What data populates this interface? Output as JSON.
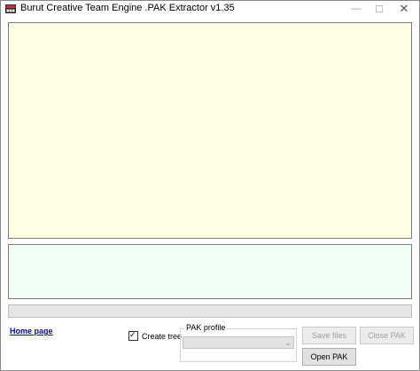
{
  "window": {
    "title": "Burut Creative Team Engine .PAK Extractor v1.35",
    "icon": "app-film-icon",
    "controls": {
      "minimize": "—",
      "maximize": "☐",
      "close": "✕"
    }
  },
  "panels": {
    "file_list_color": "#fffde3",
    "log_color": "#f0fff4"
  },
  "progress": {
    "value_percent": 0
  },
  "links": {
    "home_page": "Home page"
  },
  "options": {
    "create_tree_label": "Create tree",
    "create_tree_checked": true,
    "checkmark": "✓"
  },
  "pak_profile": {
    "label": "PAK profile",
    "selected": "",
    "arrow": "⌄"
  },
  "buttons": {
    "save_files": "Save files",
    "close_pak": "Close PAK",
    "open_pak": "Open PAK"
  }
}
